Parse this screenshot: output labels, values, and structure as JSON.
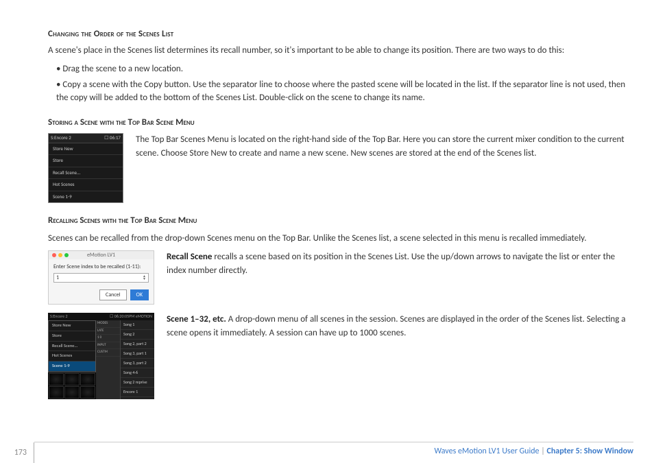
{
  "headings": {
    "changing_order": "Changing the Order of the Scenes List",
    "storing": "Storing a Scene with the Top Bar Scene Menu",
    "recalling": "Recalling Scenes with the Top Bar Scene Menu"
  },
  "paragraphs": {
    "intro": "A scene's place in the Scenes list determines its recall number, so it's important to be able to change its position. There are two ways to do this:",
    "bullet1": "Drag the scene to a new location.",
    "bullet2": "Copy a scene with the Copy button. Use the separator line to choose where the pasted scene will be located in the list. If the separator line is not used, then the copy will be added to the bottom of the Scenes List. Double-click on the scene to change its name.",
    "storing_body": "The Top Bar Scenes Menu is located on the right-hand side of the Top Bar. Here you can store the current mixer condition to the current scene. Choose Store New to create and name a new scene. New scenes are stored at the end of the Scenes list.",
    "recalling_intro": "Scenes can be recalled from the drop-down Scenes menu on the Top Bar. Unlike the Scenes list, a scene selected in this menu is recalled immediately.",
    "recall_scene_bold": "Recall Scene",
    "recall_scene_rest": " recalls a scene based on its position in the Scenes List. Use the up/down arrows to navigate the list or enter the index number directly.",
    "scene_132_bold": "Scene 1–32, etc.",
    "scene_132_rest": " A drop-down menu of all scenes in the session. Scenes are displayed in the order of the Scenes list. Selecting a scene opens it immediately. A session can have up to 1000 scenes."
  },
  "menu1": {
    "header_left": "S:Encore 2",
    "header_right": "☐ 06:17",
    "items": [
      "Store New",
      "Store",
      "Recall Scene...",
      "Hot Scenes",
      "Scene 1-9"
    ]
  },
  "dialog": {
    "title": "eMotion LV1",
    "prompt": "Enter Scene index to be recalled (1-11):",
    "value": "1",
    "cancel": "Cancel",
    "ok": "OK"
  },
  "menu3": {
    "bar_left": "S:Encore 2",
    "bar_right": "☐ 06:20:05PM  eMOTION",
    "left_items": [
      "Store New",
      "Store",
      "Recall Scene...",
      "Hot Scenes",
      "Scene 1-9"
    ],
    "mid_items": [
      "MODES",
      "LATE",
      "1  0",
      "",
      "INPUT",
      "CUSTM"
    ],
    "right_items": [
      "Song 1",
      "Song 2",
      "Song 2, part 2",
      "Song 3, part 1",
      "Song 3, part 2",
      "Song 4-6",
      "Song 2 reprise",
      "Encore 1"
    ]
  },
  "footer": {
    "page": "173",
    "guide": "Waves eMotion LV1 User Guide",
    "chapter": "Chapter 5: Show Window"
  }
}
